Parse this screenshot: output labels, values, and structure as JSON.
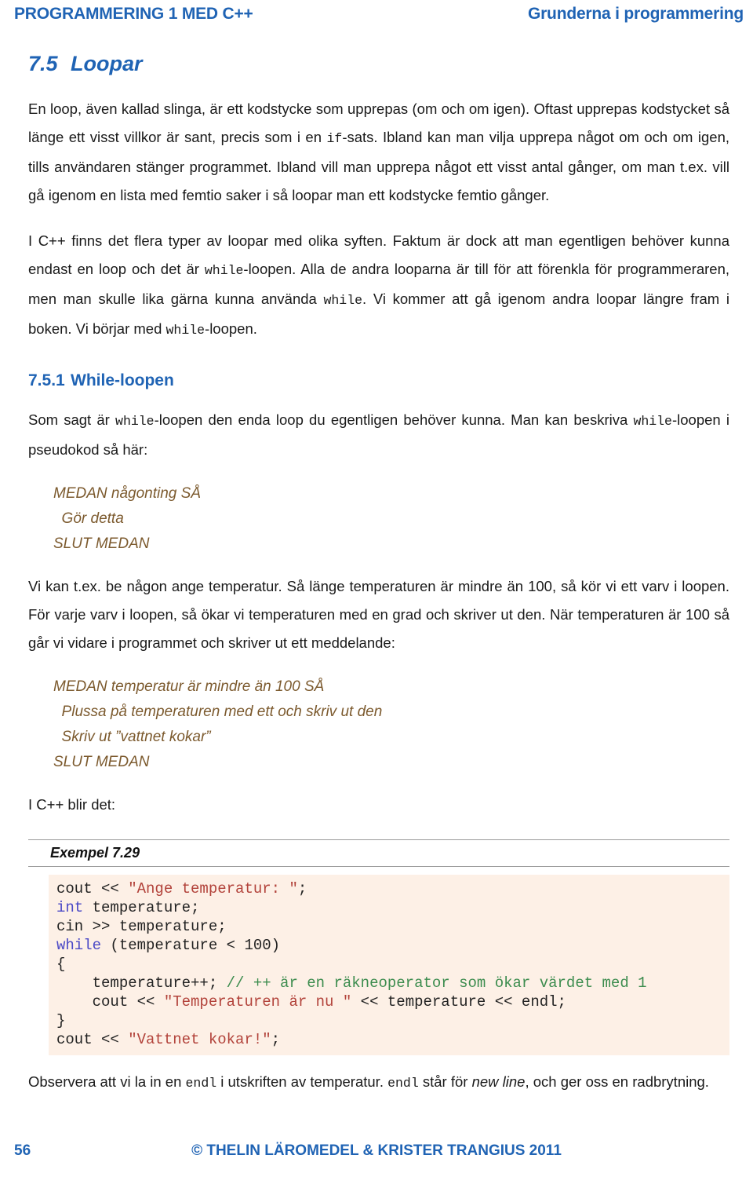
{
  "colors": {
    "heading_blue": "#1F63B4",
    "pseudocode_brown": "#7C5A2E",
    "code_bg": "#FDF0E6",
    "code_keyword": "#4B49C6",
    "code_string": "#B2423A",
    "code_comment": "#3C8C4E"
  },
  "running_header": {
    "left": "PROGRAMMERING 1 MED C++",
    "right": "Grunderna i programmering"
  },
  "section": {
    "number": "7.5",
    "title": "Loopar"
  },
  "paragraphs": {
    "intro_1": "En loop, även kallad slinga, är ett kodstycke som upprepas (om och om igen). Oftast upprepas kodstycket så länge ett visst villkor är sant, precis som i en ",
    "intro_1_code": "if",
    "intro_1_b": "-sats. Ibland kan man vilja upprepa något om och om igen, tills användaren stänger programmet. Ibland vill man upprepa något ett visst antal gånger, om man t.ex. vill gå igenom en lista med femtio saker i så loopar man ett kodstycke femtio gånger.",
    "intro_2_a": "I C++ finns det flera typer av loopar med olika syften. Faktum är dock att man egentligen behöver kunna endast en loop och det är ",
    "intro_2_code1": "while",
    "intro_2_b": "-loopen. Alla de andra looparna är till för att förenkla för programmeraren, men man skulle lika gärna kunna använda ",
    "intro_2_code2": "while",
    "intro_2_c": ". Vi kommer att gå igenom andra loopar längre fram i boken. Vi börjar med ",
    "intro_2_code3": "while",
    "intro_2_d": "-loopen."
  },
  "subsection": {
    "number": "7.5.1",
    "title": "While-loopen",
    "para_a": "Som sagt är ",
    "para_code1": "while",
    "para_b": "-loopen den enda loop du egentligen behöver kunna. Man kan beskriva ",
    "para_code2": "while",
    "para_c": "-loopen i pseudokod så här:"
  },
  "pseudocode_1": {
    "lines": [
      "MEDAN någonting SÅ",
      "  Gör detta",
      "SLUT MEDAN"
    ]
  },
  "temperature_para": "Vi kan t.ex. be någon ange temperatur. Så länge temperaturen är mindre än 100, så kör vi ett varv i loopen. För varje varv i loopen, så ökar vi temperaturen med en grad och skriver ut den. När temperaturen är 100 så går vi vidare i programmet och skriver ut ett meddelande:",
  "pseudocode_2": {
    "lines": [
      "MEDAN temperatur är mindre än 100 SÅ",
      "  Plussa på temperaturen med ett och skriv ut den",
      "  Skriv ut ”vattnet kokar”",
      "SLUT MEDAN"
    ]
  },
  "cpp_intro": "I C++ blir det:",
  "example": {
    "title": "Exempel 7.29",
    "code_lines": [
      [
        {
          "t": "cout << ",
          "c": "plain"
        },
        {
          "t": "\"Ange temperatur: \"",
          "c": "str"
        },
        {
          "t": ";",
          "c": "plain"
        }
      ],
      [
        {
          "t": "int",
          "c": "kw"
        },
        {
          "t": " temperature;",
          "c": "plain"
        }
      ],
      [
        {
          "t": "cin >> temperature;",
          "c": "plain"
        }
      ],
      [
        {
          "t": "while",
          "c": "kw"
        },
        {
          "t": " (temperature < 100)",
          "c": "plain"
        }
      ],
      [
        {
          "t": "{",
          "c": "plain"
        }
      ],
      [
        {
          "t": "    temperature++; ",
          "c": "plain"
        },
        {
          "t": "// ++ är en räkneoperator som ökar värdet med 1",
          "c": "cm"
        }
      ],
      [
        {
          "t": "    cout << ",
          "c": "plain"
        },
        {
          "t": "\"Temperaturen är nu \"",
          "c": "str"
        },
        {
          "t": " << temperature << endl;",
          "c": "plain"
        }
      ],
      [
        {
          "t": "}",
          "c": "plain"
        }
      ],
      [
        {
          "t": "cout << ",
          "c": "plain"
        },
        {
          "t": "\"Vattnet kokar!\"",
          "c": "str"
        },
        {
          "t": ";",
          "c": "plain"
        }
      ]
    ]
  },
  "closing": {
    "a": "Observera att vi la in en ",
    "code1": "endl",
    "b": " i utskriften av temperatur. ",
    "code2": "endl",
    "c": " står för ",
    "italic": "new line",
    "d": ", och ger oss en radbrytning."
  },
  "footer": {
    "page_number": "56",
    "copyright": "© THELIN LÄROMEDEL & KRISTER TRANGIUS 2011"
  }
}
